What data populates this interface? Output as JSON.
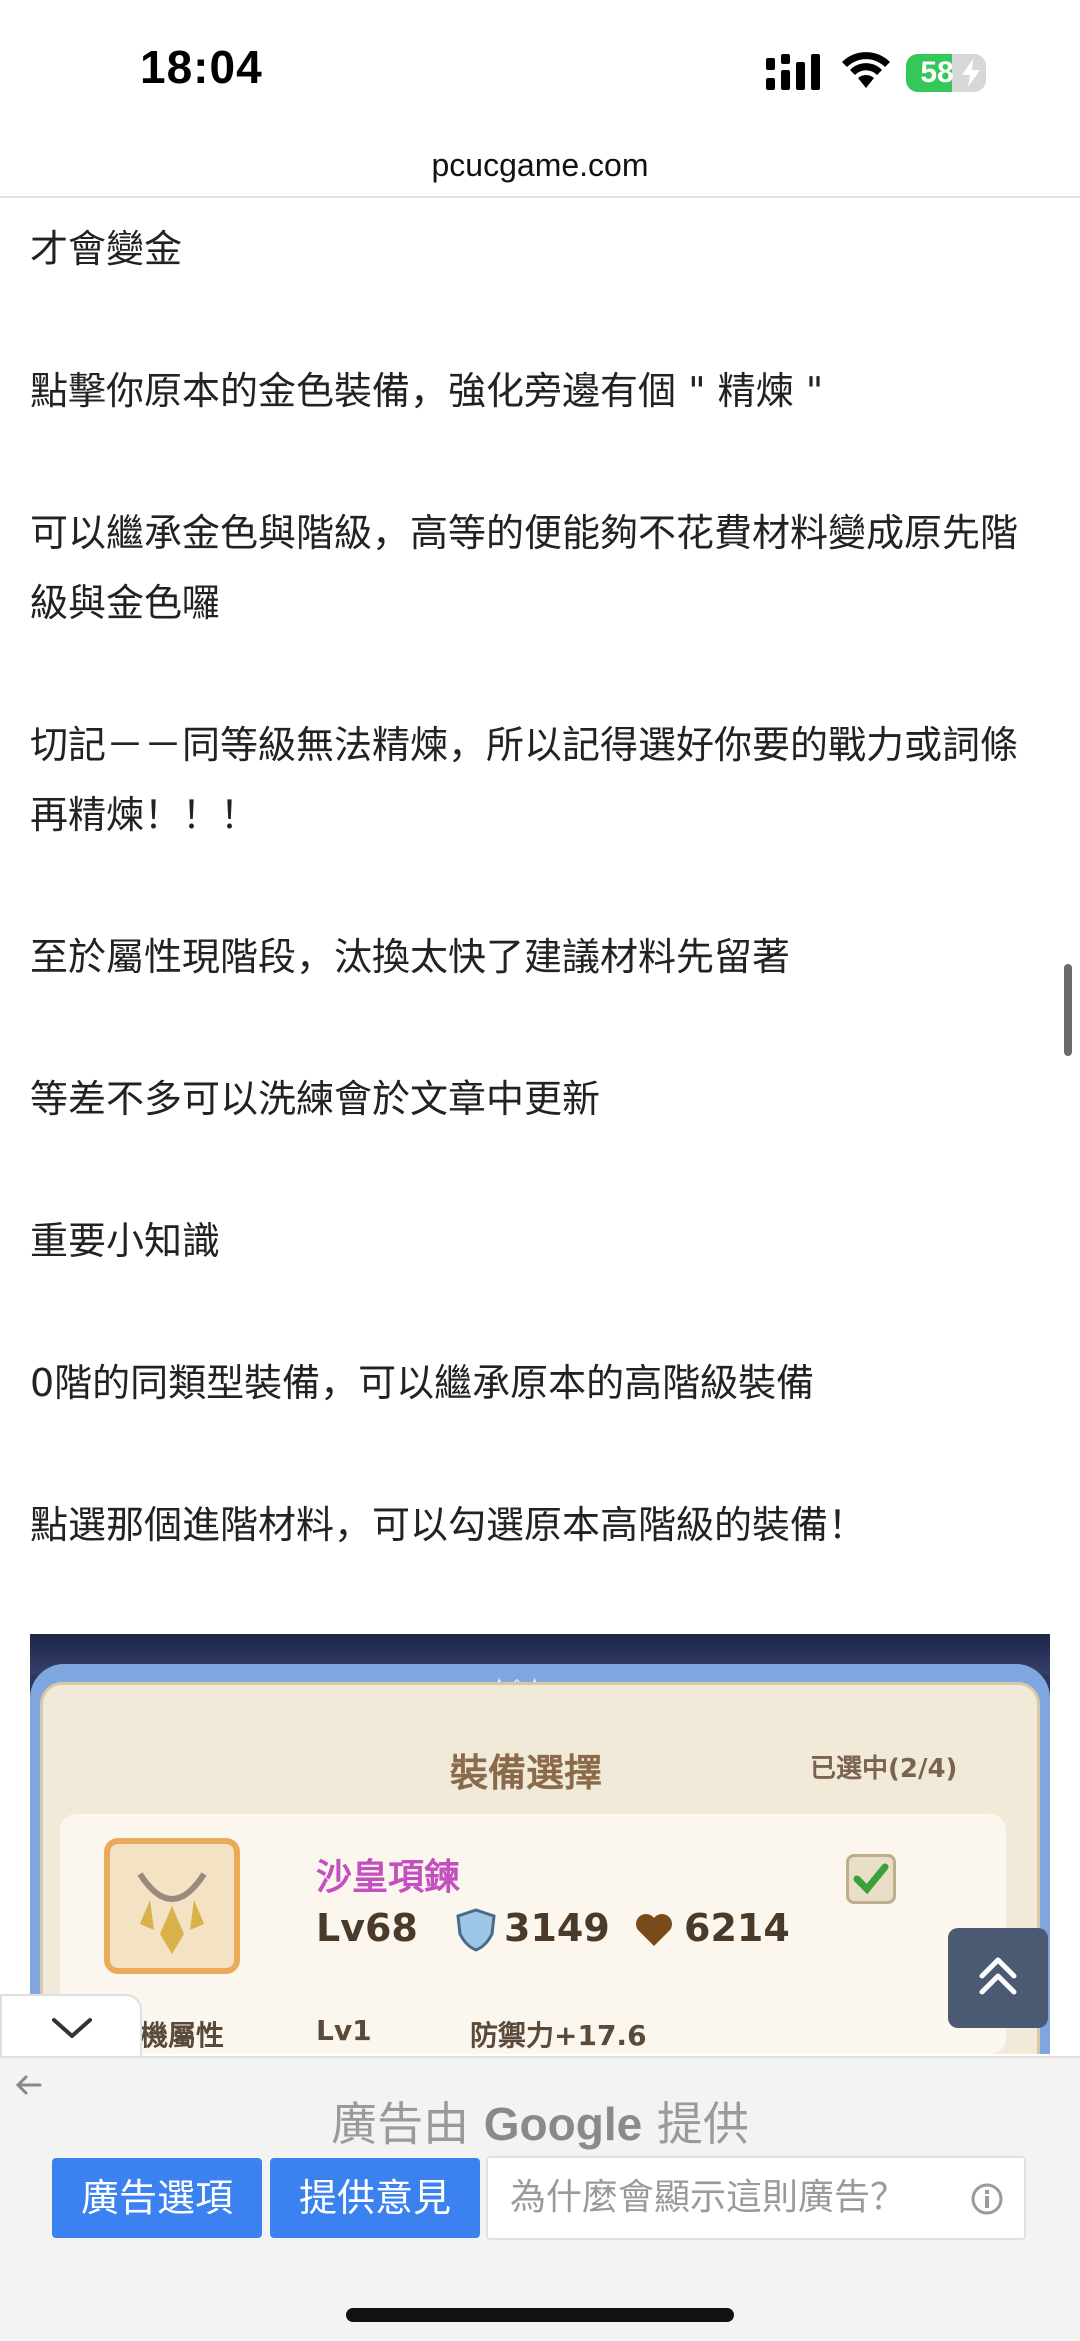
{
  "status_bar": {
    "time": "18:04",
    "battery": "58",
    "battery_level": 0.58,
    "icons": [
      "signal-icon",
      "wifi-icon",
      "battery-icon",
      "charging-bolt-icon"
    ]
  },
  "browser": {
    "url": "pcucgame.com"
  },
  "article": {
    "paragraphs": [
      "才會變金",
      "點擊你原本的金色裝備，強化旁邊有個 \" 精煉 \"",
      "可以繼承金色與階級，高等的便能夠不花費材料變成原先階級與金色囉",
      "切記－－同等級無法精煉，所以記得選好你要的戰力或詞條再精煉！！！",
      "至於屬性現階段，汰換太快了建議材料先留著",
      "等差不多可以洗練會於文章中更新",
      "重要小知識",
      "0階的同類型裝備，可以繼承原本的高階級裝備",
      "點選那個進階材料，可以勾選原本高階級的裝備！"
    ]
  },
  "game_screenshot": {
    "panel_title": "裝備選擇",
    "selected_count": "已選中(2/4)",
    "item_name": "沙皇項鍊",
    "item_level": "Lv68",
    "item_defense": "3149",
    "item_hp": "6214",
    "row2_label": "機屬性",
    "row2_level": "Lv1",
    "row2_stat": "防禦力+17.6"
  },
  "ad": {
    "provided_by_prefix": "廣告由",
    "provided_by_brand": "Google",
    "provided_by_suffix": "提供",
    "options_button": "廣告選項",
    "feedback_button": "提供意見",
    "why_text": "為什麼會顯示這則廣告？"
  },
  "colors": {
    "accent_blue": "#3b82f0",
    "back_to_top_bg": "#4b5a73",
    "battery_green": "#34c759",
    "item_name_purple": "#c44fbf"
  }
}
